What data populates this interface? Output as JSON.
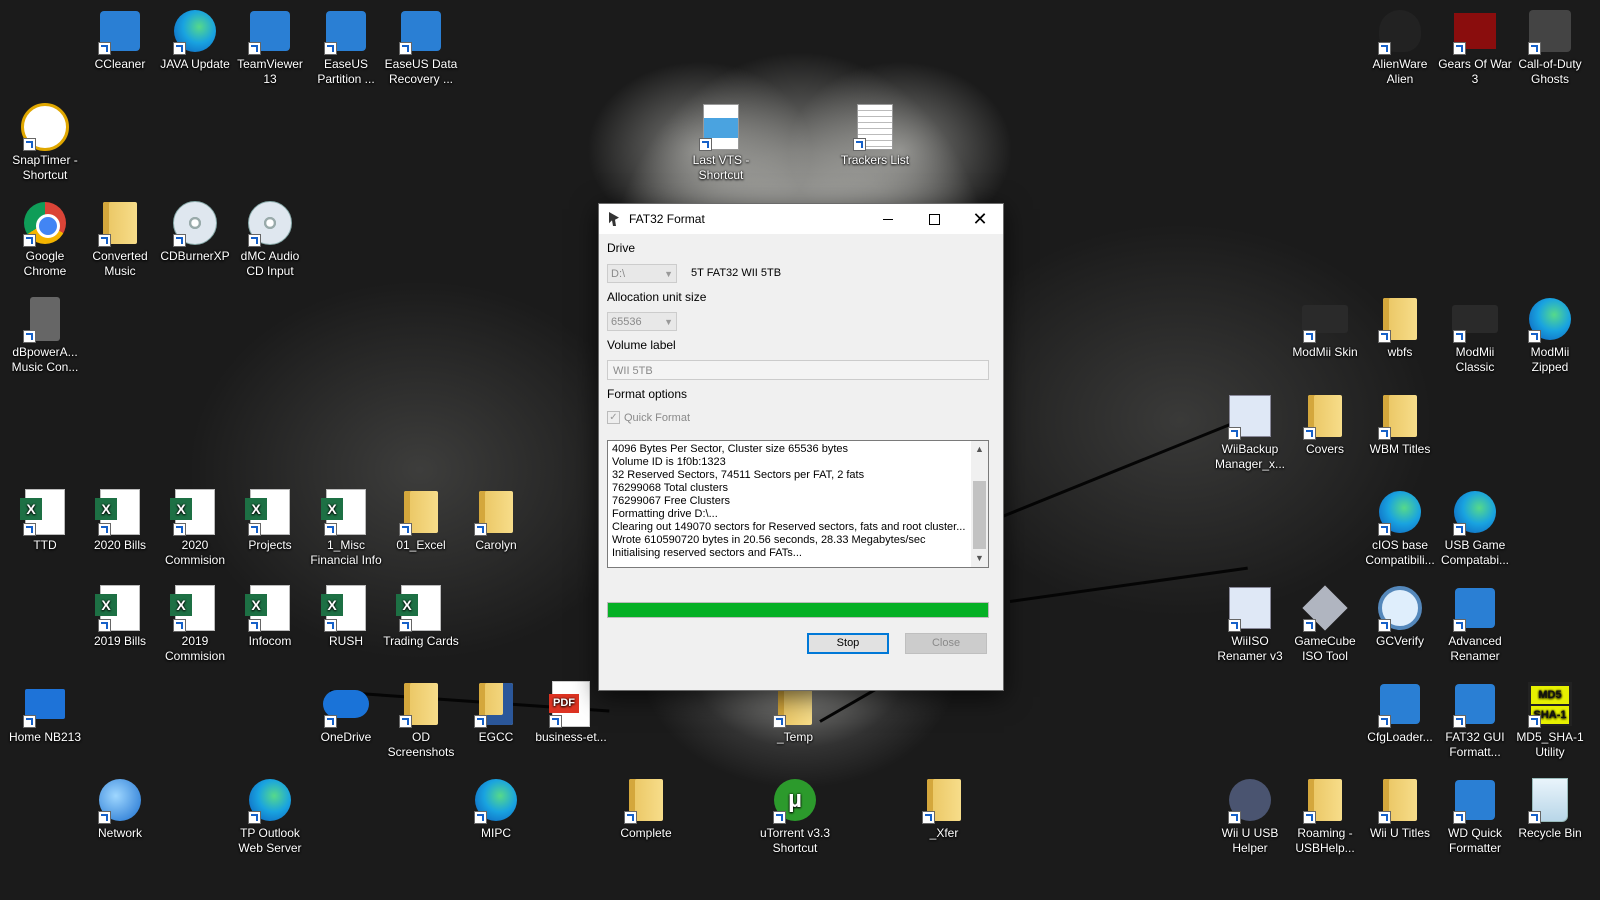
{
  "desktop": {
    "icons": [
      {
        "label": "CCleaner",
        "glyph": "ccleaner-icon"
      },
      {
        "label": "JAVA Update",
        "glyph": "edge-icon"
      },
      {
        "label": "TeamViewer 13",
        "glyph": "teamviewer-icon"
      },
      {
        "label": "EaseUS Partition ...",
        "glyph": "easeus-partition-icon"
      },
      {
        "label": "EaseUS Data Recovery ...",
        "glyph": "easeus-recovery-icon"
      },
      {
        "label": "AlienWare Alien",
        "glyph": "alienware-icon"
      },
      {
        "label": "Gears Of War 3",
        "glyph": "gears-of-war-icon"
      },
      {
        "label": "Call-of-Duty Ghosts",
        "glyph": "cod-ghosts-icon"
      },
      {
        "label": "SnapTimer - Shortcut",
        "glyph": "clock-icon"
      },
      {
        "label": "Last VTS - Shortcut",
        "glyph": "image-file-icon"
      },
      {
        "label": "Trackers List",
        "glyph": "text-file-icon"
      },
      {
        "label": "Google Chrome",
        "glyph": "chrome-icon"
      },
      {
        "label": "Converted Music",
        "glyph": "folder-icon"
      },
      {
        "label": "CDBurnerXP",
        "glyph": "disc-icon"
      },
      {
        "label": "dMC Audio CD Input",
        "glyph": "disc-icon"
      },
      {
        "label": "dBpowerA... Music Con...",
        "glyph": "speaker-icon"
      },
      {
        "label": "ModMii Skin",
        "glyph": "modmii-icon"
      },
      {
        "label": "wbfs",
        "glyph": "folder-icon"
      },
      {
        "label": "ModMii Classic",
        "glyph": "modmii-icon"
      },
      {
        "label": "ModMii Zipped",
        "glyph": "edge-icon"
      },
      {
        "label": "WiiBackup Manager_x...",
        "glyph": "wiibackup-icon"
      },
      {
        "label": "Covers",
        "glyph": "folder-icon"
      },
      {
        "label": "WBM Titles",
        "glyph": "folder-icon"
      },
      {
        "label": "TTD",
        "glyph": "excel-icon"
      },
      {
        "label": "2020 Bills",
        "glyph": "excel-icon"
      },
      {
        "label": "2020 Commision",
        "glyph": "excel-icon"
      },
      {
        "label": "Projects",
        "glyph": "excel-icon"
      },
      {
        "label": "1_Misc Financial Info",
        "glyph": "excel-icon"
      },
      {
        "label": "01_Excel",
        "glyph": "folder-icon"
      },
      {
        "label": "Carolyn",
        "glyph": "folder-icon"
      },
      {
        "label": "cIOS base Compatibili...",
        "glyph": "edge-icon"
      },
      {
        "label": "USB Game Compatabi...",
        "glyph": "edge-icon"
      },
      {
        "label": "2019 Bills",
        "glyph": "excel-icon"
      },
      {
        "label": "2019 Commision",
        "glyph": "excel-icon"
      },
      {
        "label": "Infocom",
        "glyph": "excel-icon"
      },
      {
        "label": "RUSH",
        "glyph": "excel-icon"
      },
      {
        "label": "Trading Cards",
        "glyph": "excel-icon"
      },
      {
        "label": "WiiISO Renamer v3",
        "glyph": "wiiiso-icon"
      },
      {
        "label": "GameCube ISO Tool",
        "glyph": "gamecube-icon"
      },
      {
        "label": "GCVerify",
        "glyph": "magnifier-icon"
      },
      {
        "label": "Advanced Renamer",
        "glyph": "renamer-icon"
      },
      {
        "label": "Home NB213",
        "glyph": "computer-icon"
      },
      {
        "label": "OneDrive",
        "glyph": "onedrive-icon"
      },
      {
        "label": "OD Screenshots",
        "glyph": "folder-icon"
      },
      {
        "label": "EGCC",
        "glyph": "word-folder-icon"
      },
      {
        "label": "business-et...",
        "glyph": "pdf-icon"
      },
      {
        "label": "_Temp",
        "glyph": "folder-icon"
      },
      {
        "label": "CfgLoader...",
        "glyph": "cfgloader-icon"
      },
      {
        "label": "FAT32 GUI Formatt...",
        "glyph": "fat32-gui-icon"
      },
      {
        "label": "MD5_SHA-1 Utility",
        "glyph": "md5-icon"
      },
      {
        "label": "Network",
        "glyph": "network-icon"
      },
      {
        "label": "TP Outlook Web Server",
        "glyph": "edge-icon"
      },
      {
        "label": "MIPC",
        "glyph": "edge-icon"
      },
      {
        "label": "Complete",
        "glyph": "folder-icon"
      },
      {
        "label": "uTorrent v3.3 Shortcut",
        "glyph": "utorrent-icon"
      },
      {
        "label": "_Xfer",
        "glyph": "folder-icon"
      },
      {
        "label": "Wii U USB Helper",
        "glyph": "rocket-icon"
      },
      {
        "label": "Roaming - USBHelp...",
        "glyph": "folder-icon"
      },
      {
        "label": "Wii U Titles",
        "glyph": "folder-icon"
      },
      {
        "label": "WD Quick Formatter",
        "glyph": "wd-formatter-icon"
      },
      {
        "label": "Recycle Bin",
        "glyph": "recycle-bin-icon"
      }
    ]
  },
  "dialog": {
    "title": "FAT32 Format",
    "drive_label": "Drive",
    "drive_value": "D:\\",
    "drive_description": "5T FAT32 WII 5TB",
    "alloc_label": "Allocation unit size",
    "alloc_value": "65536",
    "volume_label": "Volume label",
    "volume_value": "WII 5TB",
    "format_options_label": "Format options",
    "quick_format_label": "Quick Format",
    "log_lines": [
      "4096 Bytes Per Sector, Cluster size 65536 bytes",
      "Volume ID is 1f0b:1323",
      "32 Reserved Sectors, 74511 Sectors per FAT, 2 fats",
      "76299068 Total clusters",
      "76299067 Free Clusters",
      "Formatting drive D:\\...",
      "Clearing out 149070 sectors for Reserved sectors, fats and root cluster...",
      "Wrote 610590720 bytes in 20.56 seconds, 28.33 Megabytes/sec",
      "Initialising reserved sectors and FATs..."
    ],
    "progress_percent": 100,
    "stop_label": "Stop",
    "close_label": "Close",
    "minimize_glyph": "minimize-icon",
    "maximize_glyph": "maximize-icon",
    "close_glyph": "✕",
    "progress_color": "#06b025"
  }
}
